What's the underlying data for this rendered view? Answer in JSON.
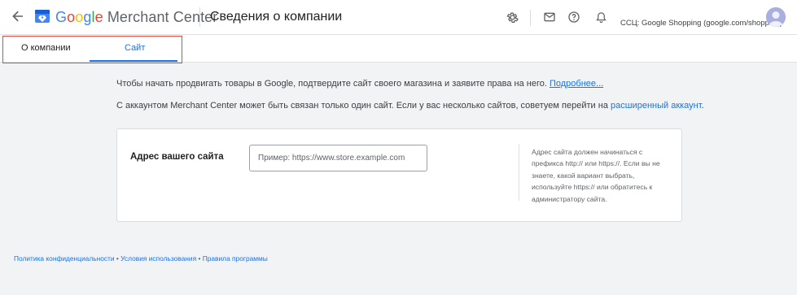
{
  "header": {
    "brand_google": "Google",
    "brand_product": "Merchant Center",
    "page_title": "Сведения о компании",
    "account_label": "ССЦ: Google Shopping (google.com/shopping)",
    "icons": [
      "back-arrow-icon",
      "merchant-center-logo-icon",
      "settings-icon",
      "mail-icon",
      "help-icon",
      "bell-icon",
      "avatar"
    ]
  },
  "tabs": [
    {
      "label": "О компании",
      "active": false
    },
    {
      "label": "Сайт",
      "active": true
    }
  ],
  "intro": {
    "line1_text": "Чтобы начать продвигать товары в Google, подтвердите сайт своего магазина и заявите права на него.",
    "line1_link": "Подробнее...",
    "line2_text": "С аккаунтом Merchant Center может быть связан только один сайт. Если у вас несколько сайтов, советуем перейти на",
    "line2_link": "расширенный аккаунт",
    "line2_end": "."
  },
  "card": {
    "field_label": "Адрес вашего сайта",
    "input_value": "",
    "input_placeholder": "Пример: https://www.store.example.com",
    "help_text": "Адрес сайта должен начинаться с префикса http:// или https://. Если вы не знаете, какой вариант выбрать, используйте https:// или обратитесь к администратору сайта."
  },
  "footer": {
    "privacy": "Политика конфиденциальности",
    "terms": "Условия использования",
    "program": "Правила программы",
    "separator": "•"
  },
  "colors": {
    "accent": "#1a73e8",
    "highlight_box": "#e8453c",
    "background": "#f1f3f4"
  }
}
